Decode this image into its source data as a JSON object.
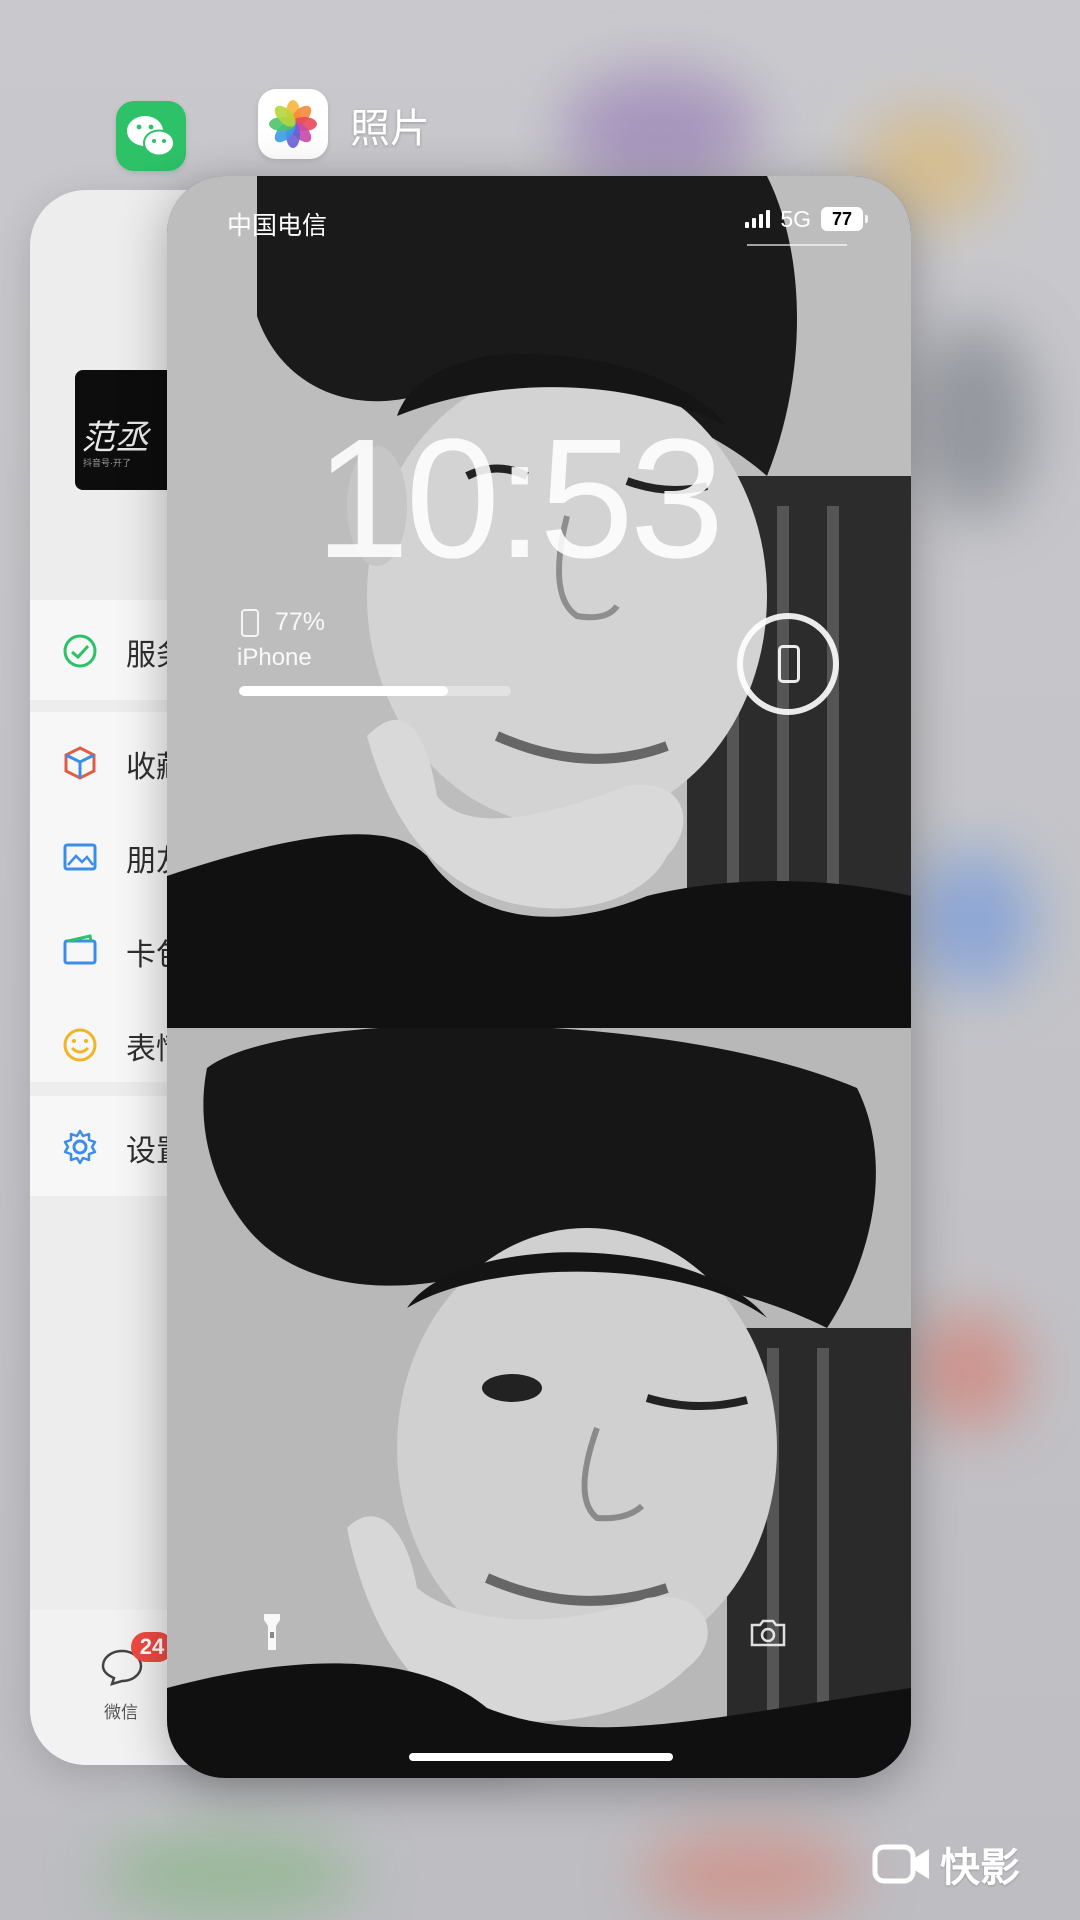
{
  "switcher": {
    "active_app_title": "照片"
  },
  "wechat": {
    "thumbnail_text": "范丞",
    "thumbnail_subtext": "抖音号·开了",
    "menu": [
      {
        "label": "服务",
        "icon": "service-icon"
      },
      {
        "label": "收藏",
        "icon": "favorites-icon"
      },
      {
        "label": "朋友",
        "icon": "moments-icon"
      },
      {
        "label": "卡包",
        "icon": "card-wallet-icon"
      },
      {
        "label": "表情",
        "icon": "sticker-icon"
      },
      {
        "label": "设置",
        "icon": "settings-icon"
      }
    ],
    "tab_label": "微信",
    "badge_count": "24",
    "accent_color": "#2dc168"
  },
  "lockscreen": {
    "carrier": "中国电信",
    "network": "5G",
    "battery_level": "77",
    "time": "10:53",
    "widget_percent": "77%",
    "widget_device": "iPhone",
    "widget_progress": 0.77
  },
  "watermark": {
    "text": "快影"
  }
}
